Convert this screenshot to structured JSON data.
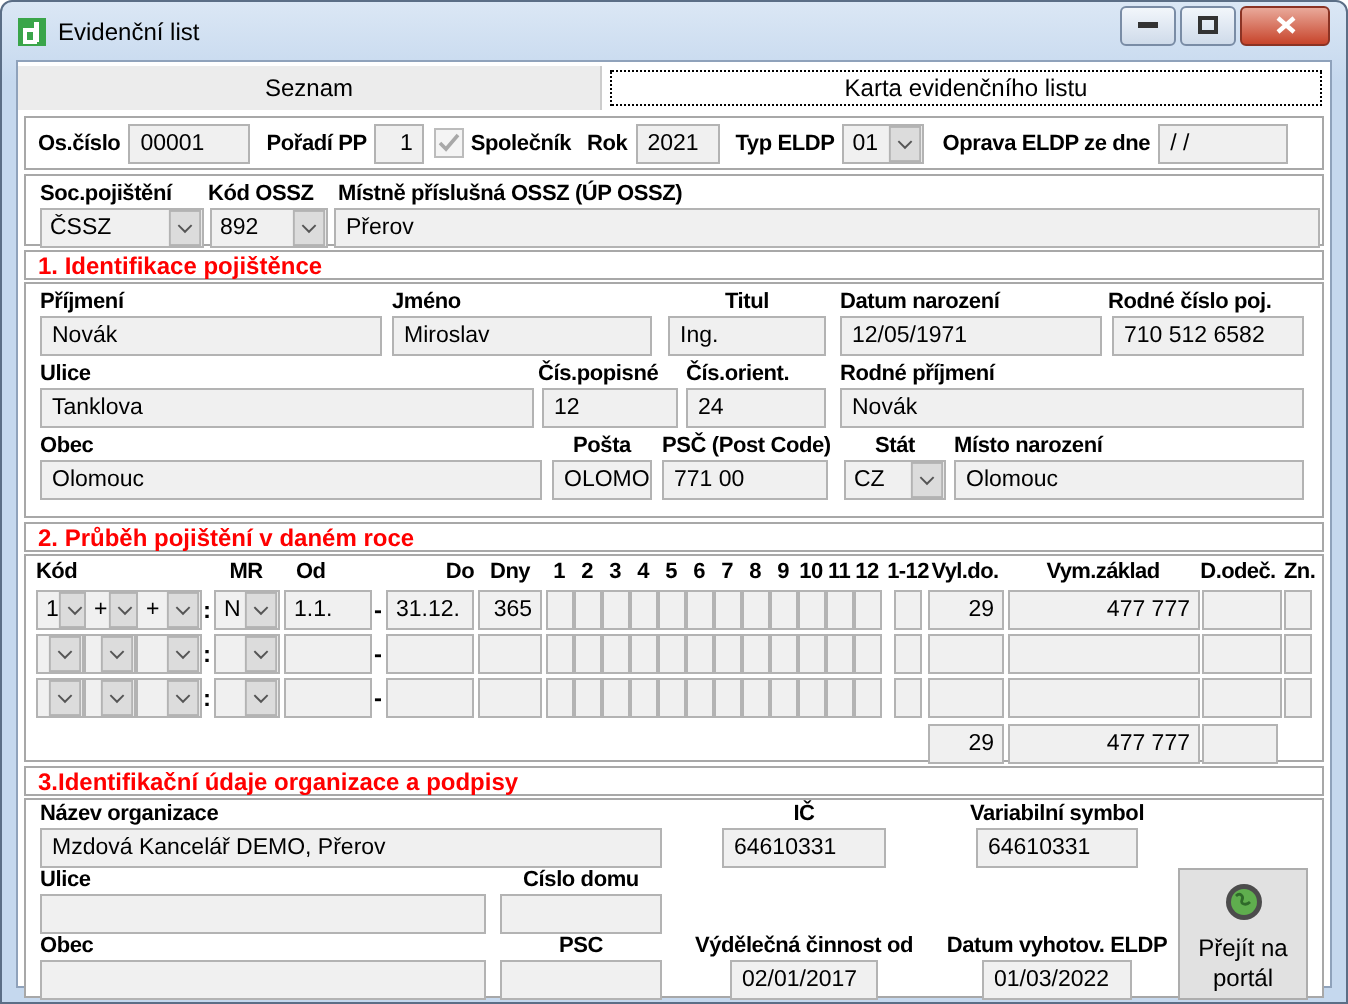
{
  "window": {
    "title": "Evidenční list"
  },
  "tabs": [
    {
      "label": "Seznam",
      "selected": false
    },
    {
      "label": "Karta evidenčního listu",
      "selected": true
    }
  ],
  "header": {
    "fields": [
      {
        "kind": "text",
        "label": "Os.číslo",
        "value": "00001"
      },
      {
        "kind": "text",
        "label": "Pořadí PP",
        "value": "1"
      },
      {
        "kind": "checkbox",
        "label": "Společník",
        "checked": true
      },
      {
        "kind": "text",
        "label": "Rok",
        "value": "2021"
      },
      {
        "kind": "combo",
        "label": "Typ ELDP",
        "value": "01"
      },
      {
        "kind": "text",
        "label": "Oprava ELDP ze dne",
        "value": "/ /"
      }
    ]
  },
  "office": {
    "fields": [
      {
        "kind": "combo",
        "label": "Soc.pojištění",
        "value": "ČSSZ"
      },
      {
        "kind": "combo",
        "label": "Kód OSSZ",
        "value": "892"
      },
      {
        "kind": "text",
        "label": "Místně příslušná OSSZ (ÚP OSSZ)",
        "value": "Přerov"
      }
    ]
  },
  "insured": {
    "title": "1. Identifikace pojištěnce",
    "rows": [
      [
        {
          "kind": "text",
          "label": "Příjmení",
          "value": "Novák"
        },
        {
          "kind": "text",
          "label": "Jméno",
          "value": "Miroslav"
        },
        {
          "kind": "text",
          "label": "Titul",
          "value": "Ing."
        },
        {
          "kind": "text",
          "label": "Datum narození",
          "value": "12/05/1971"
        },
        {
          "kind": "text",
          "label": "Rodné číslo poj.",
          "value": "710 512 6582"
        }
      ],
      [
        {
          "kind": "text",
          "label": "Ulice",
          "value": "Tanklova"
        },
        {
          "kind": "text",
          "label": "Čís.popisné",
          "value": "12"
        },
        {
          "kind": "text",
          "label": "Čís.orient.",
          "value": "24"
        },
        {
          "kind": "text",
          "label": "Rodné příjmení",
          "value": "Novák"
        }
      ],
      [
        {
          "kind": "text",
          "label": "Obec",
          "value": "Olomouc"
        },
        {
          "kind": "text",
          "label": "Pošta",
          "value": "OLOMO"
        },
        {
          "kind": "text",
          "label": "PSČ (Post Code)",
          "value": "771 00"
        },
        {
          "kind": "combo",
          "label": "Stát",
          "value": "CZ"
        },
        {
          "kind": "text",
          "label": "Místo narození",
          "value": "Olomouc"
        }
      ]
    ]
  },
  "insurance": {
    "title": "2. Průběh pojištění v daném roce",
    "columns": [
      "Kód",
      "MR",
      "Od",
      "Do",
      "Dny",
      "1",
      "2",
      "3",
      "4",
      "5",
      "6",
      "7",
      "8",
      "9",
      "10",
      "11",
      "12",
      "1-12",
      "Vyl.do.",
      "Vym.základ",
      "D.odeč.",
      "Zn."
    ],
    "rows": [
      {
        "kod": [
          "1",
          "+",
          "+"
        ],
        "kod_separator": ":",
        "mr": "N",
        "od": "1.1.",
        "range_separator": "-",
        "do": "31.12.",
        "dny": "365",
        "vyl_do": "29",
        "vym_zaklad": "477 777"
      },
      {
        "kod_separator": ":",
        "range_separator": "-"
      },
      {
        "kod_separator": ":",
        "range_separator": "-"
      }
    ],
    "totals": {
      "vyl_do": "29",
      "vym_zaklad": "477 777"
    }
  },
  "organization": {
    "title": "3.Identifikační údaje organizace a podpisy",
    "fields": [
      {
        "kind": "text",
        "label": "Název organizace",
        "value": "Mzdová Kancelář DEMO, Přerov"
      },
      {
        "kind": "text",
        "label": "IČ",
        "value": "64610331"
      },
      {
        "kind": "text",
        "label": "Variabilní symbol",
        "value": "64610331"
      },
      {
        "kind": "text",
        "label": "Ulice"
      },
      {
        "kind": "text",
        "label": "Císlo domu"
      },
      {
        "kind": "text",
        "label": "Obec"
      },
      {
        "kind": "text",
        "label": "PSC"
      },
      {
        "kind": "text",
        "label": "Výdělečná činnost od",
        "value": "02/01/2017"
      },
      {
        "kind": "text",
        "label": "Datum vyhotov. ELDP",
        "value": "01/03/2022"
      }
    ],
    "button": {
      "label": "Přejít na portál"
    }
  }
}
